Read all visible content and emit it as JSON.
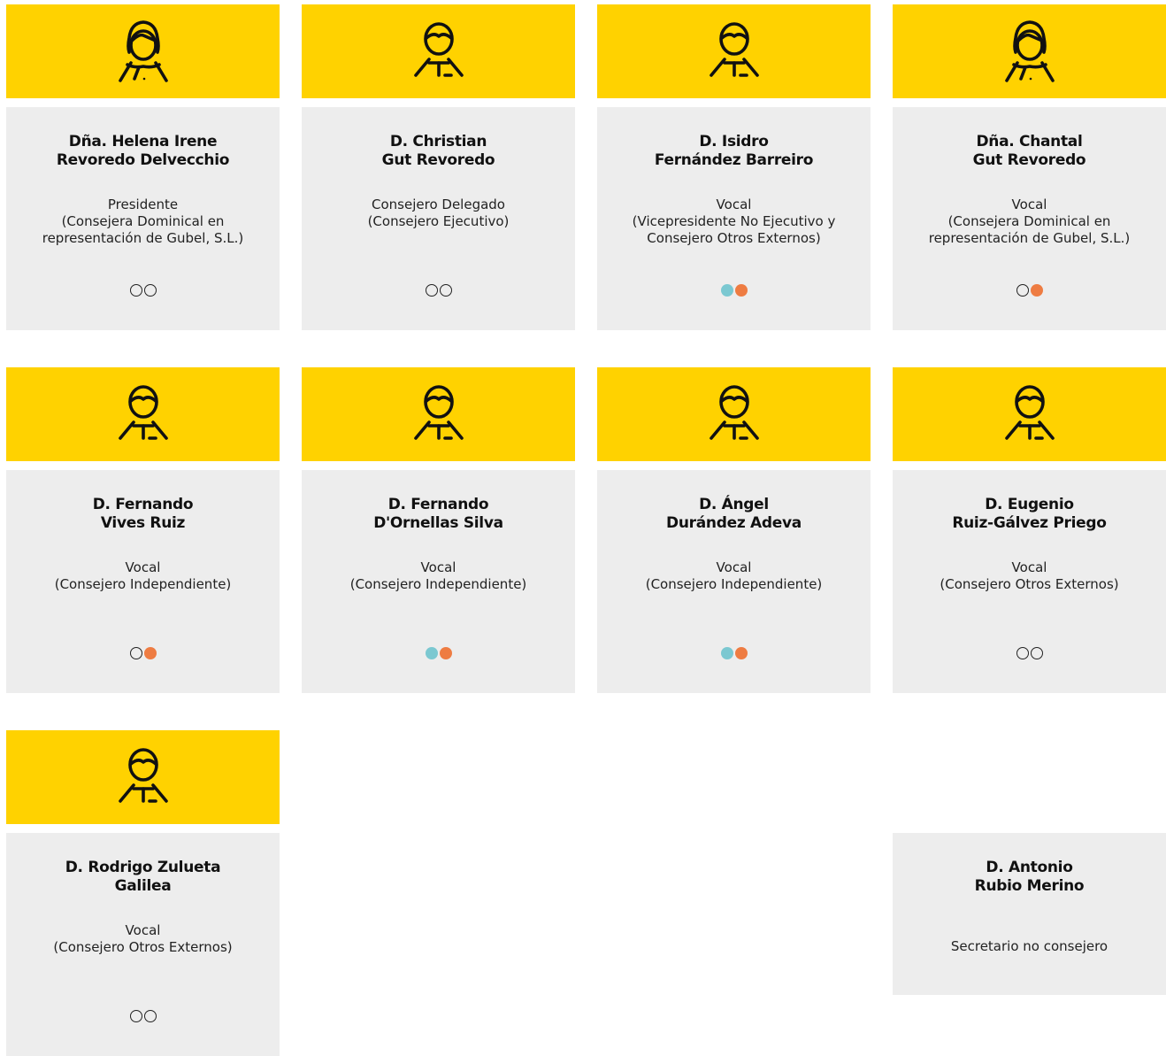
{
  "colors": {
    "header_yellow": "#FFD200",
    "card_gray": "#EDEDED",
    "dot_teal": "#7BC8D1",
    "dot_orange": "#EE7C42"
  },
  "members": [
    {
      "name_line1": "Dña. Helena Irene",
      "name_line2": "Revoredo Delvecchio",
      "role_lines": [
        "Presidente",
        "(Consejera Dominical en",
        "representación de Gubel, S.L.)"
      ],
      "avatar_icon": "female-avatar-icon",
      "dots": [
        "empty",
        "empty"
      ]
    },
    {
      "name_line1": "D. Christian",
      "name_line2": "Gut Revoredo",
      "role_lines": [
        "Consejero Delegado",
        "(Consejero Ejecutivo)"
      ],
      "avatar_icon": "male-avatar-icon",
      "dots": [
        "empty",
        "empty"
      ]
    },
    {
      "name_line1": "D. Isidro",
      "name_line2": "Fernández Barreiro",
      "role_lines": [
        "Vocal",
        "(Vicepresidente No Ejecutivo y",
        "Consejero Otros Externos)"
      ],
      "avatar_icon": "male-avatar-icon",
      "dots": [
        "teal",
        "orange"
      ]
    },
    {
      "name_line1": "Dña. Chantal",
      "name_line2": "Gut Revoredo",
      "role_lines": [
        "Vocal",
        "(Consejera Dominical en",
        "representación de Gubel, S.L.)"
      ],
      "avatar_icon": "female-avatar-icon",
      "dots": [
        "empty",
        "orange"
      ]
    },
    {
      "name_line1": "D. Fernando",
      "name_line2": "Vives Ruiz",
      "role_lines": [
        "Vocal",
        "(Consejero Independiente)"
      ],
      "avatar_icon": "male-avatar-icon",
      "dots": [
        "empty",
        "orange"
      ]
    },
    {
      "name_line1": "D. Fernando",
      "name_line2": "D'Ornellas Silva",
      "role_lines": [
        "Vocal",
        "(Consejero Independiente)"
      ],
      "avatar_icon": "male-avatar-icon",
      "dots": [
        "teal",
        "orange"
      ]
    },
    {
      "name_line1": "D. Ángel",
      "name_line2": "Durández Adeva",
      "role_lines": [
        "Vocal",
        "(Consejero Independiente)"
      ],
      "avatar_icon": "male-avatar-icon",
      "dots": [
        "teal",
        "orange"
      ]
    },
    {
      "name_line1": "D. Eugenio",
      "name_line2": "Ruiz-Gálvez Priego",
      "role_lines": [
        "Vocal",
        "(Consejero Otros Externos)"
      ],
      "avatar_icon": "male-avatar-icon",
      "dots": [
        "empty",
        "empty"
      ]
    },
    {
      "name_line1": "D. Rodrigo Zulueta",
      "name_line2": "Galilea",
      "role_lines": [
        "Vocal",
        "(Consejero Otros Externos)"
      ],
      "avatar_icon": "male-avatar-icon",
      "dots": [
        "empty",
        "empty"
      ]
    }
  ],
  "secretary": {
    "name_line1": "D. Antonio",
    "name_line2": "Rubio Merino",
    "role": "Secretario no consejero"
  }
}
